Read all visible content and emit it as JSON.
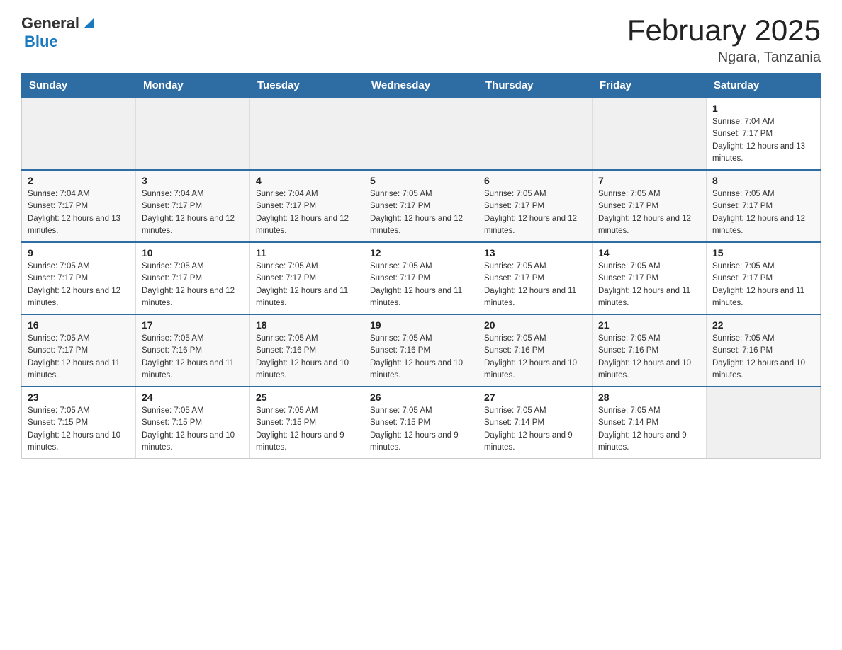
{
  "header": {
    "logo": {
      "general": "General",
      "blue": "Blue",
      "tagline": ""
    },
    "title": "February 2025",
    "location": "Ngara, Tanzania"
  },
  "weekdays": [
    "Sunday",
    "Monday",
    "Tuesday",
    "Wednesday",
    "Thursday",
    "Friday",
    "Saturday"
  ],
  "weeks": [
    [
      {
        "day": "",
        "info": ""
      },
      {
        "day": "",
        "info": ""
      },
      {
        "day": "",
        "info": ""
      },
      {
        "day": "",
        "info": ""
      },
      {
        "day": "",
        "info": ""
      },
      {
        "day": "",
        "info": ""
      },
      {
        "day": "1",
        "info": "Sunrise: 7:04 AM\nSunset: 7:17 PM\nDaylight: 12 hours and 13 minutes."
      }
    ],
    [
      {
        "day": "2",
        "info": "Sunrise: 7:04 AM\nSunset: 7:17 PM\nDaylight: 12 hours and 13 minutes."
      },
      {
        "day": "3",
        "info": "Sunrise: 7:04 AM\nSunset: 7:17 PM\nDaylight: 12 hours and 12 minutes."
      },
      {
        "day": "4",
        "info": "Sunrise: 7:04 AM\nSunset: 7:17 PM\nDaylight: 12 hours and 12 minutes."
      },
      {
        "day": "5",
        "info": "Sunrise: 7:05 AM\nSunset: 7:17 PM\nDaylight: 12 hours and 12 minutes."
      },
      {
        "day": "6",
        "info": "Sunrise: 7:05 AM\nSunset: 7:17 PM\nDaylight: 12 hours and 12 minutes."
      },
      {
        "day": "7",
        "info": "Sunrise: 7:05 AM\nSunset: 7:17 PM\nDaylight: 12 hours and 12 minutes."
      },
      {
        "day": "8",
        "info": "Sunrise: 7:05 AM\nSunset: 7:17 PM\nDaylight: 12 hours and 12 minutes."
      }
    ],
    [
      {
        "day": "9",
        "info": "Sunrise: 7:05 AM\nSunset: 7:17 PM\nDaylight: 12 hours and 12 minutes."
      },
      {
        "day": "10",
        "info": "Sunrise: 7:05 AM\nSunset: 7:17 PM\nDaylight: 12 hours and 12 minutes."
      },
      {
        "day": "11",
        "info": "Sunrise: 7:05 AM\nSunset: 7:17 PM\nDaylight: 12 hours and 11 minutes."
      },
      {
        "day": "12",
        "info": "Sunrise: 7:05 AM\nSunset: 7:17 PM\nDaylight: 12 hours and 11 minutes."
      },
      {
        "day": "13",
        "info": "Sunrise: 7:05 AM\nSunset: 7:17 PM\nDaylight: 12 hours and 11 minutes."
      },
      {
        "day": "14",
        "info": "Sunrise: 7:05 AM\nSunset: 7:17 PM\nDaylight: 12 hours and 11 minutes."
      },
      {
        "day": "15",
        "info": "Sunrise: 7:05 AM\nSunset: 7:17 PM\nDaylight: 12 hours and 11 minutes."
      }
    ],
    [
      {
        "day": "16",
        "info": "Sunrise: 7:05 AM\nSunset: 7:17 PM\nDaylight: 12 hours and 11 minutes."
      },
      {
        "day": "17",
        "info": "Sunrise: 7:05 AM\nSunset: 7:16 PM\nDaylight: 12 hours and 11 minutes."
      },
      {
        "day": "18",
        "info": "Sunrise: 7:05 AM\nSunset: 7:16 PM\nDaylight: 12 hours and 10 minutes."
      },
      {
        "day": "19",
        "info": "Sunrise: 7:05 AM\nSunset: 7:16 PM\nDaylight: 12 hours and 10 minutes."
      },
      {
        "day": "20",
        "info": "Sunrise: 7:05 AM\nSunset: 7:16 PM\nDaylight: 12 hours and 10 minutes."
      },
      {
        "day": "21",
        "info": "Sunrise: 7:05 AM\nSunset: 7:16 PM\nDaylight: 12 hours and 10 minutes."
      },
      {
        "day": "22",
        "info": "Sunrise: 7:05 AM\nSunset: 7:16 PM\nDaylight: 12 hours and 10 minutes."
      }
    ],
    [
      {
        "day": "23",
        "info": "Sunrise: 7:05 AM\nSunset: 7:15 PM\nDaylight: 12 hours and 10 minutes."
      },
      {
        "day": "24",
        "info": "Sunrise: 7:05 AM\nSunset: 7:15 PM\nDaylight: 12 hours and 10 minutes."
      },
      {
        "day": "25",
        "info": "Sunrise: 7:05 AM\nSunset: 7:15 PM\nDaylight: 12 hours and 9 minutes."
      },
      {
        "day": "26",
        "info": "Sunrise: 7:05 AM\nSunset: 7:15 PM\nDaylight: 12 hours and 9 minutes."
      },
      {
        "day": "27",
        "info": "Sunrise: 7:05 AM\nSunset: 7:14 PM\nDaylight: 12 hours and 9 minutes."
      },
      {
        "day": "28",
        "info": "Sunrise: 7:05 AM\nSunset: 7:14 PM\nDaylight: 12 hours and 9 minutes."
      },
      {
        "day": "",
        "info": ""
      }
    ]
  ]
}
